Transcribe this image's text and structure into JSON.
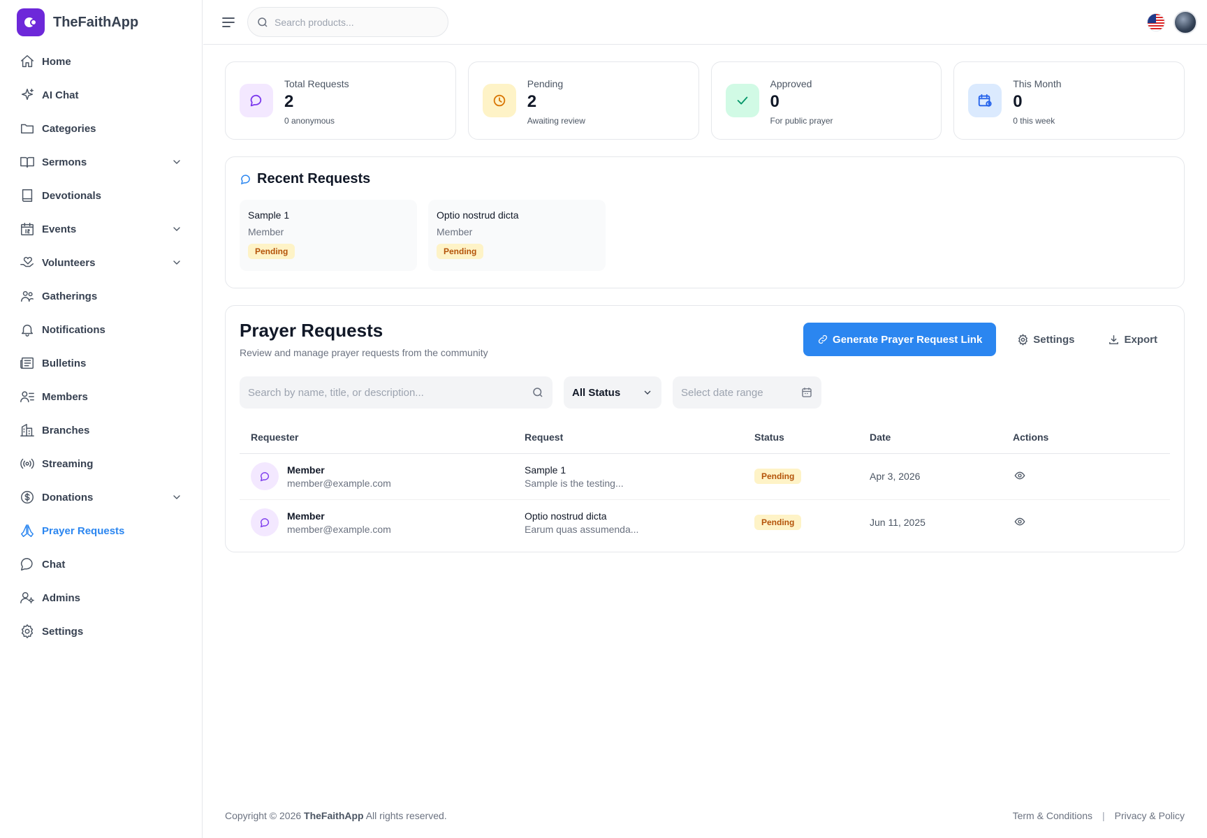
{
  "app": {
    "name": "TheFaithApp"
  },
  "colors": {
    "accent": "#2b86f0",
    "brand": "#6d28d9",
    "pending_bg": "#fef3c7",
    "pending_text": "#b45309"
  },
  "sidebar": {
    "items": [
      {
        "label": "Home",
        "icon": "home-icon"
      },
      {
        "label": "AI Chat",
        "icon": "sparkles-icon"
      },
      {
        "label": "Categories",
        "icon": "folder-icon"
      },
      {
        "label": "Sermons",
        "icon": "book-open-icon",
        "expandable": true
      },
      {
        "label": "Devotionals",
        "icon": "book-icon"
      },
      {
        "label": "Events",
        "icon": "calendar-icon",
        "expandable": true
      },
      {
        "label": "Volunteers",
        "icon": "hand-heart-icon",
        "expandable": true
      },
      {
        "label": "Gatherings",
        "icon": "users-icon"
      },
      {
        "label": "Notifications",
        "icon": "bell-icon"
      },
      {
        "label": "Bulletins",
        "icon": "newspaper-icon"
      },
      {
        "label": "Members",
        "icon": "user-list-icon"
      },
      {
        "label": "Branches",
        "icon": "building-icon"
      },
      {
        "label": "Streaming",
        "icon": "broadcast-icon"
      },
      {
        "label": "Donations",
        "icon": "dollar-icon",
        "expandable": true
      },
      {
        "label": "Prayer Requests",
        "icon": "praying-hands-icon",
        "active": true
      },
      {
        "label": "Chat",
        "icon": "chat-bubble-icon"
      },
      {
        "label": "Admins",
        "icon": "user-cog-icon"
      },
      {
        "label": "Settings",
        "icon": "gear-icon"
      }
    ]
  },
  "topbar": {
    "search_placeholder": "Search products..."
  },
  "stats": [
    {
      "title": "Total Requests",
      "value": "2",
      "sub": "0 anonymous"
    },
    {
      "title": "Pending",
      "value": "2",
      "sub": "Awaiting review"
    },
    {
      "title": "Approved",
      "value": "0",
      "sub": "For public prayer"
    },
    {
      "title": "This Month",
      "value": "0",
      "sub": "0 this week"
    }
  ],
  "recent": {
    "title": "Recent Requests",
    "items": [
      {
        "title": "Sample 1",
        "role": "Member",
        "status": "Pending"
      },
      {
        "title": "Optio nostrud dicta",
        "role": "Member",
        "status": "Pending"
      }
    ]
  },
  "requests": {
    "title": "Prayer Requests",
    "subtitle": "Review and manage prayer requests from the community",
    "generate_label": "Generate Prayer Request Link",
    "settings_label": "Settings",
    "export_label": "Export",
    "search_placeholder": "Search by name, title, or description...",
    "status_filter": "All Status",
    "date_placeholder": "Select date range",
    "columns": [
      "Requester",
      "Request",
      "Status",
      "Date",
      "Actions"
    ],
    "rows": [
      {
        "name": "Member",
        "email": "member@example.com",
        "title": "Sample 1",
        "desc": "Sample is the testing...",
        "status": "Pending",
        "date": "Apr 3, 2026"
      },
      {
        "name": "Member",
        "email": "member@example.com",
        "title": "Optio nostrud dicta",
        "desc": "Earum quas assumenda...",
        "status": "Pending",
        "date": "Jun 11, 2025"
      }
    ]
  },
  "footer": {
    "copyright_prefix": "Copyright © 2026",
    "brand": "TheFaithApp",
    "copyright_suffix": "All rights reserved.",
    "terms": "Term & Conditions",
    "privacy": "Privacy & Policy"
  }
}
